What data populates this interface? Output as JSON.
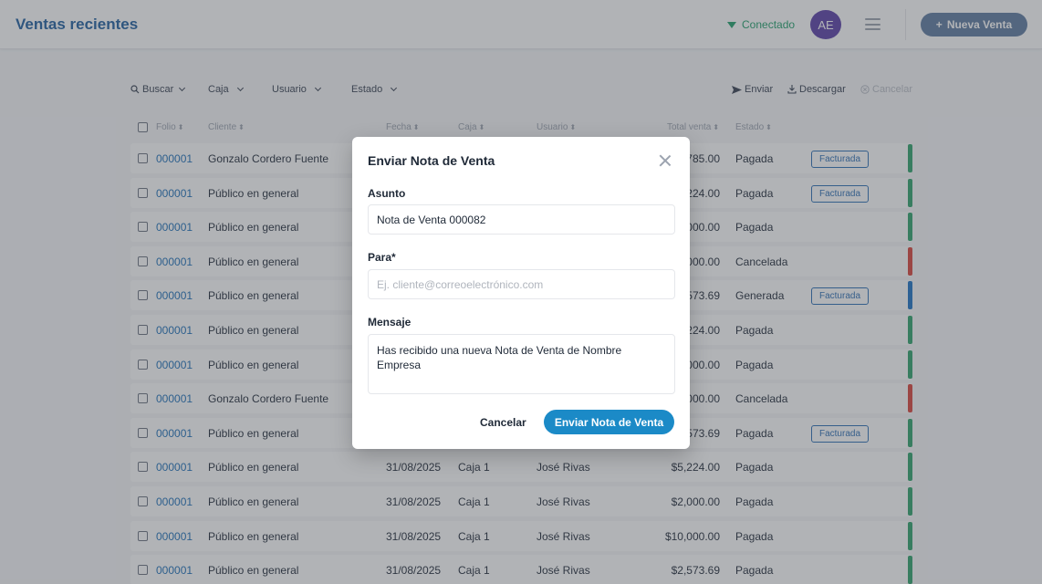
{
  "header": {
    "title": "Ventas recientes",
    "status": "Conectado",
    "avatar_initials": "AE",
    "new_sale_label": "Nueva Venta",
    "status_color": "#22a06b"
  },
  "toolbar": {
    "search": "Buscar",
    "caja": "Caja",
    "usuario": "Usuario",
    "estado": "Estado",
    "send": "Enviar",
    "download": "Descargar",
    "cancel": "Cancelar"
  },
  "table": {
    "columns": [
      "Folio",
      "Cliente",
      "Fecha",
      "Caja",
      "Usuario",
      "Total venta",
      "Estado"
    ],
    "rows": [
      {
        "folio": "000001",
        "cliente": "Gonzalo Cordero Fuente",
        "fecha": "",
        "caja": "",
        "usuario": "",
        "total": "785.00",
        "estado": "Pagada",
        "badge": "Facturada",
        "status_color": "#2fa36b"
      },
      {
        "folio": "000001",
        "cliente": "Público en general",
        "fecha": "",
        "caja": "",
        "usuario": "",
        "total": "224.00",
        "estado": "Pagada",
        "badge": "Facturada",
        "status_color": "#2fa36b"
      },
      {
        "folio": "000001",
        "cliente": "Público en general",
        "fecha": "",
        "caja": "",
        "usuario": "",
        "total": "000.00",
        "estado": "Pagada",
        "badge": "",
        "status_color": "#2fa36b"
      },
      {
        "folio": "000001",
        "cliente": "Público en general",
        "fecha": "",
        "caja": "",
        "usuario": "",
        "total": "000.00",
        "estado": "Cancelada",
        "badge": "",
        "status_color": "#d9443b"
      },
      {
        "folio": "000001",
        "cliente": "Público en general",
        "fecha": "",
        "caja": "",
        "usuario": "",
        "total": "573.69",
        "estado": "Generada",
        "badge": "Facturada",
        "status_color": "#1d72c4"
      },
      {
        "folio": "000001",
        "cliente": "Público en general",
        "fecha": "",
        "caja": "",
        "usuario": "",
        "total": "224.00",
        "estado": "Pagada",
        "badge": "",
        "status_color": "#2fa36b"
      },
      {
        "folio": "000001",
        "cliente": "Público en general",
        "fecha": "",
        "caja": "",
        "usuario": "",
        "total": "000.00",
        "estado": "Pagada",
        "badge": "",
        "status_color": "#2fa36b"
      },
      {
        "folio": "000001",
        "cliente": "Gonzalo Cordero Fuente",
        "fecha": "",
        "caja": "",
        "usuario": "",
        "total": "000.00",
        "estado": "Cancelada",
        "badge": "",
        "status_color": "#d9443b"
      },
      {
        "folio": "000001",
        "cliente": "Público en general",
        "fecha": "",
        "caja": "",
        "usuario": "",
        "total": "573.69",
        "estado": "Pagada",
        "badge": "Facturada",
        "status_color": "#2fa36b"
      },
      {
        "folio": "000001",
        "cliente": "Público en general",
        "fecha": "31/08/2025",
        "caja": "Caja 1",
        "usuario": "José Rivas",
        "total": "$5,224.00",
        "estado": "Pagada",
        "badge": "",
        "status_color": "#2fa36b"
      },
      {
        "folio": "000001",
        "cliente": "Público en general",
        "fecha": "31/08/2025",
        "caja": "Caja 1",
        "usuario": "José Rivas",
        "total": "$2,000.00",
        "estado": "Pagada",
        "badge": "",
        "status_color": "#2fa36b"
      },
      {
        "folio": "000001",
        "cliente": "Público en general",
        "fecha": "31/08/2025",
        "caja": "Caja 1",
        "usuario": "José Rivas",
        "total": "$10,000.00",
        "estado": "Pagada",
        "badge": "",
        "status_color": "#2fa36b"
      },
      {
        "folio": "000001",
        "cliente": "Público en general",
        "fecha": "31/08/2025",
        "caja": "Caja 1",
        "usuario": "José Rivas",
        "total": "$2,573.69",
        "estado": "Pagada",
        "badge": "",
        "status_color": "#2fa36b"
      }
    ]
  },
  "modal": {
    "title": "Enviar Nota de Venta",
    "subject_label": "Asunto",
    "subject_value": "Nota de Venta 000082",
    "to_label": "Para*",
    "to_placeholder": "Ej. cliente@correoelectrónico.com",
    "message_label": "Mensaje",
    "message_value": "Has recibido una nueva Nota de Venta de Nombre Empresa",
    "cancel_label": "Cancelar",
    "send_label": "Enviar Nota de Venta"
  }
}
